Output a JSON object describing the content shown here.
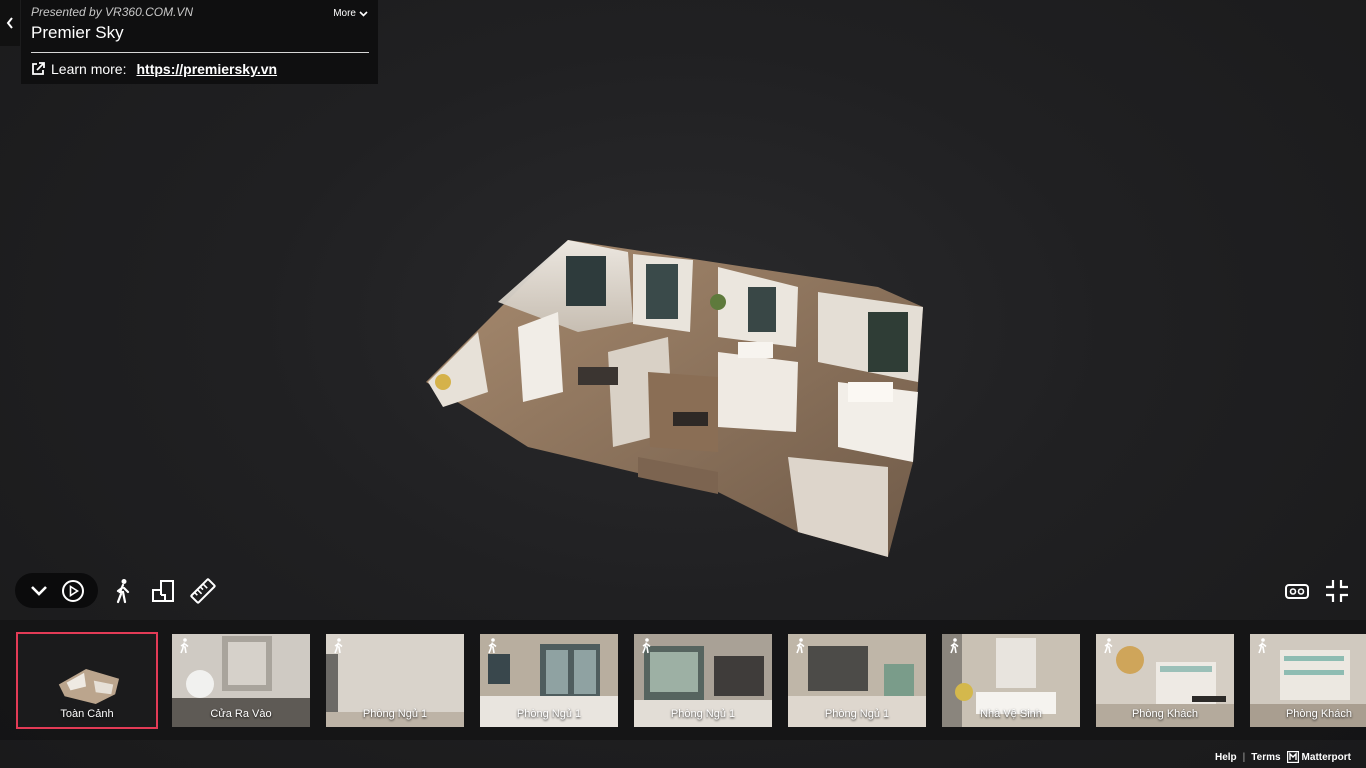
{
  "header": {
    "presented_prefix": "Presented by ",
    "presenter": "VR360.COM.VN",
    "more_label": "More",
    "title": "Premier Sky",
    "learn_label": "Learn more:",
    "learn_link": "https://premiersky.vn"
  },
  "controls": {
    "left": [
      "chevron-down-icon",
      "play-icon",
      "walk-icon",
      "floorplan-icon",
      "measure-icon"
    ],
    "right": [
      "vr-headset-icon",
      "exit-fullscreen-icon"
    ]
  },
  "thumbnails": [
    {
      "label": "Toàn Cảnh",
      "active": true
    },
    {
      "label": "Cửa Ra Vào",
      "active": false
    },
    {
      "label": "Phòng Ngủ 1",
      "active": false
    },
    {
      "label": "Phòng Ngủ 1",
      "active": false
    },
    {
      "label": "Phòng Ngủ 1",
      "active": false
    },
    {
      "label": "Phòng Ngủ 1",
      "active": false
    },
    {
      "label": "Nhà Vệ Sinh",
      "active": false
    },
    {
      "label": "Phòng Khách",
      "active": false
    },
    {
      "label": "Phòng Khách",
      "active": false
    }
  ],
  "footer": {
    "help": "Help",
    "separator": "|",
    "terms": "Terms",
    "brand": "Matterport"
  },
  "colors": {
    "background": "#1f1f21",
    "active_thumb_border": "#e33b56"
  }
}
